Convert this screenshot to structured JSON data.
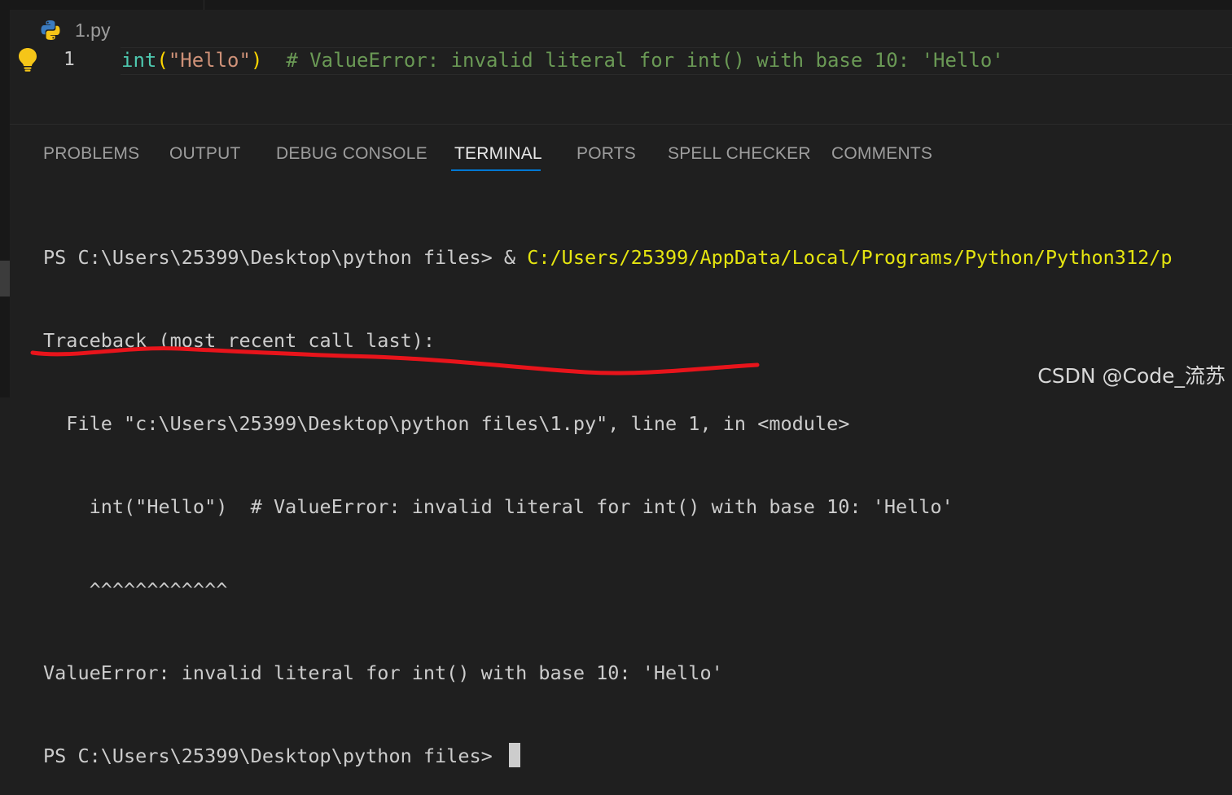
{
  "editor": {
    "file_name": "1.py",
    "line_number": "1",
    "code": {
      "fn": "int",
      "open_paren": "(",
      "string": "\"Hello\"",
      "close_paren": ")",
      "comment": "  # ValueError: invalid literal for int() with base 10: 'Hello'"
    }
  },
  "panel": {
    "tabs": [
      {
        "label": "PROBLEMS"
      },
      {
        "label": "OUTPUT"
      },
      {
        "label": "DEBUG CONSOLE"
      },
      {
        "label": "TERMINAL"
      },
      {
        "label": "PORTS"
      },
      {
        "label": "SPELL CHECKER"
      },
      {
        "label": "COMMENTS"
      }
    ],
    "active_tab": "TERMINAL"
  },
  "terminal": {
    "prompt1": "PS C:\\Users\\25399\\Desktop\\python files> & ",
    "command_path": "C:/Users/25399/AppData/Local/Programs/Python/Python312/p",
    "lines": [
      "Traceback (most recent call last):",
      "  File \"c:\\Users\\25399\\Desktop\\python files\\1.py\", line 1, in <module>",
      "    int(\"Hello\")  # ValueError: invalid literal for int() with base 10: 'Hello'",
      "    ^^^^^^^^^^^^",
      "ValueError: invalid literal for int() with base 10: 'Hello'"
    ],
    "prompt2": "PS C:\\Users\\25399\\Desktop\\python files> "
  },
  "watermark": "CSDN @Code_流苏",
  "colors": {
    "annotation_stroke": "#e8141b",
    "accent": "#0078d4",
    "path_yellow": "#e5e510"
  }
}
